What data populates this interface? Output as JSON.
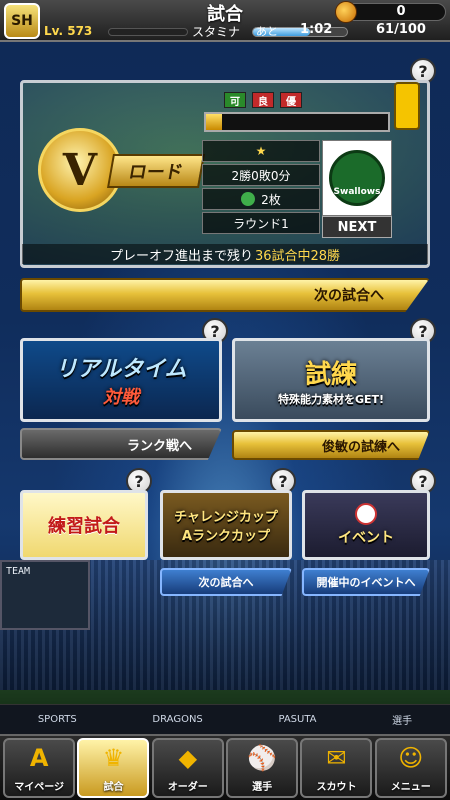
{
  "header": {
    "logo_text": "SH",
    "title": "試合",
    "coins": "0",
    "level_label": "Lv. 573",
    "stamina_label": "スタミナ",
    "remain_label": "あと",
    "remain_time": "1:02",
    "stamina_value": "61/100",
    "stamina_fill": 0.61
  },
  "vroad": {
    "emblem_letter": "V",
    "emblem_text": "ロード",
    "flags": [
      "可",
      "良",
      "優"
    ],
    "flag_colors": [
      "#2a8a2a",
      "#c22a2a",
      "#c22a2a"
    ],
    "progress_fill": 0.09,
    "star": "★",
    "record": "2勝0敗0分",
    "tickets": "2枚",
    "round": "ラウンド1",
    "opponent_logo_text": "Swallows",
    "next_label": "NEXT",
    "progress_text_a": "プレーオフ進出まで残り",
    "progress_text_b": "36試合中28勝"
  },
  "buttons": {
    "next_match": "次の試合へ",
    "rank_match": "ランク戦へ",
    "trial": "俊敏の試練へ",
    "challenge_next": "次の試合へ",
    "event_next": "開催中のイベントへ"
  },
  "cards": {
    "realtime_line1": "リアルタイム",
    "realtime_line2": "対戦",
    "trial_title": "試練",
    "trial_sub": "特殊能力素材をGET!",
    "practice": "練習試合",
    "challenge_line1": "チャレンジカップ",
    "challenge_line2": "Aランクカップ",
    "event": "イベント"
  },
  "help_icon": "?",
  "background": {
    "scoreboard_label": "TEAM",
    "ads": [
      "SPORTS",
      "DRAGONS",
      "PASUTA",
      "選手"
    ]
  },
  "nav": [
    {
      "label": "マイページ",
      "glyph": "A",
      "active": false
    },
    {
      "label": "試合",
      "glyph": "♛",
      "active": true
    },
    {
      "label": "オーダー",
      "glyph": "◆",
      "active": false
    },
    {
      "label": "選手",
      "glyph": "⚾",
      "active": false
    },
    {
      "label": "スカウト",
      "glyph": "✉",
      "active": false
    },
    {
      "label": "メニュー",
      "glyph": "☺",
      "active": false
    }
  ]
}
